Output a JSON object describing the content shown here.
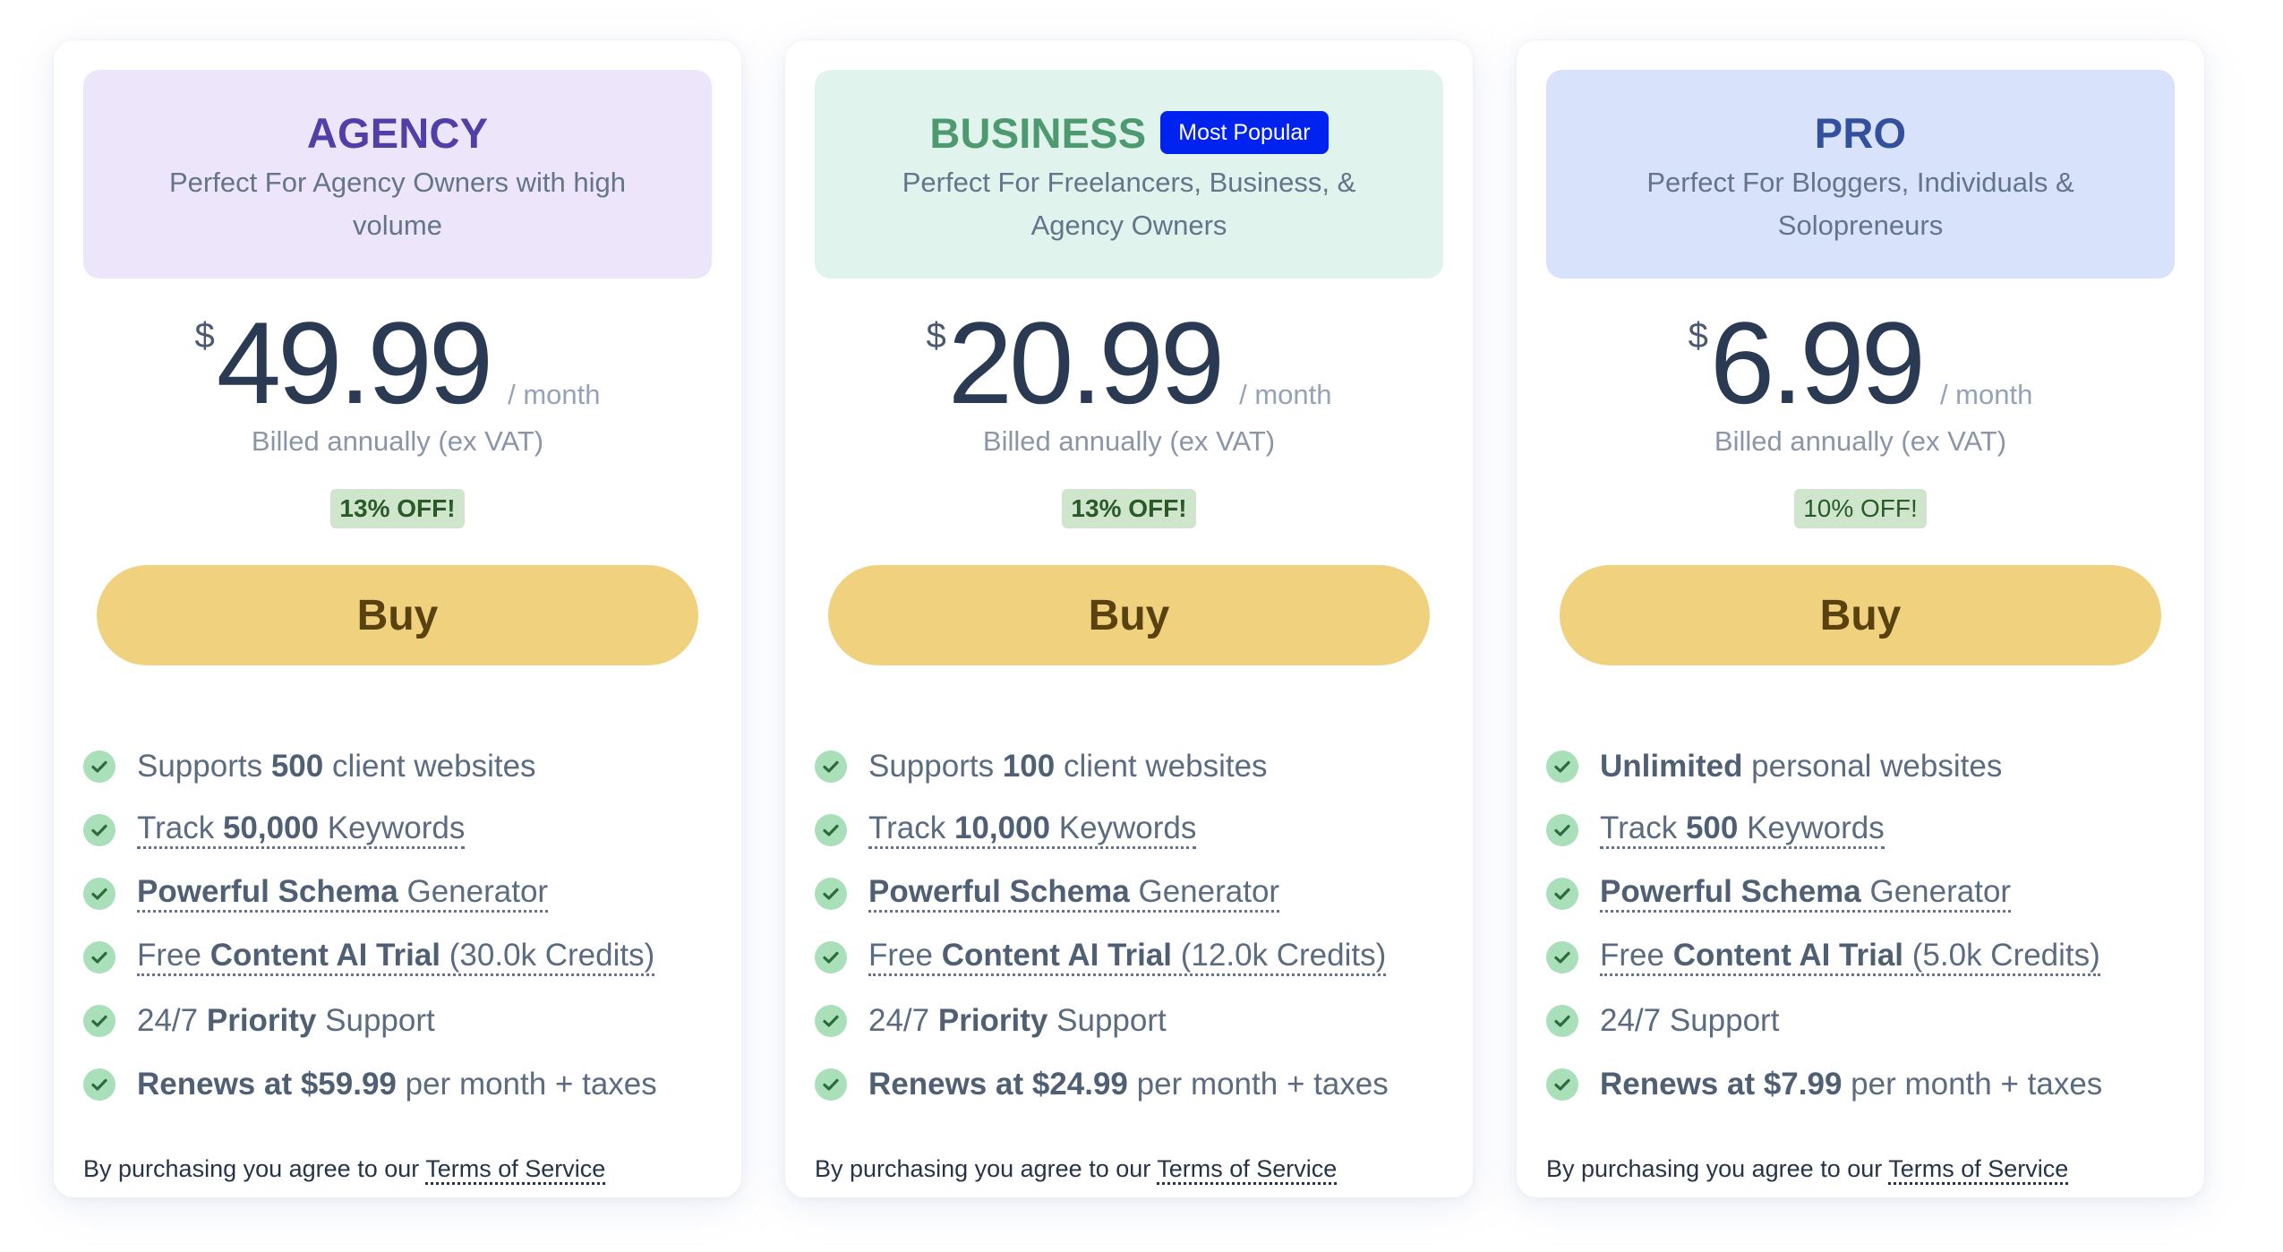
{
  "plans": [
    {
      "name": "AGENCY",
      "name_color": "#4f3fa6",
      "header_bg": "#ede6fb",
      "badge": null,
      "description": "Perfect For Agency Owners with high volume",
      "currency": "$",
      "price": "49.99",
      "period": "/ month",
      "billing_note": "Billed annually (ex VAT)",
      "discount": "13% OFF!",
      "buy_label": "Buy",
      "features": [
        {
          "parts": [
            {
              "t": "Supports ",
              "b": false
            },
            {
              "t": "500",
              "b": true
            },
            {
              "t": " client websites",
              "b": false
            }
          ],
          "dotted": false
        },
        {
          "parts": [
            {
              "t": "Track ",
              "b": false
            },
            {
              "t": "50,000",
              "b": true
            },
            {
              "t": " Keywords",
              "b": false
            }
          ],
          "dotted": true
        },
        {
          "parts": [
            {
              "t": "Powerful Schema",
              "b": true
            },
            {
              "t": " Generator",
              "b": false
            }
          ],
          "dotted": true
        },
        {
          "parts": [
            {
              "t": "Free ",
              "b": false
            },
            {
              "t": "Content AI Trial",
              "b": true
            },
            {
              "t": " (30.0k Credits)",
              "b": false
            }
          ],
          "dotted": true
        },
        {
          "parts": [
            {
              "t": "24/7 ",
              "b": false
            },
            {
              "t": "Priority",
              "b": true
            },
            {
              "t": " Support",
              "b": false
            }
          ],
          "dotted": false
        },
        {
          "parts": [
            {
              "t": "Renews at $59.99",
              "b": true
            },
            {
              "t": " per month + taxes",
              "b": false
            }
          ],
          "dotted": false
        }
      ],
      "terms_prefix": "By purchasing you agree to our ",
      "terms_link": "Terms of Service"
    },
    {
      "name": "BUSINESS",
      "name_color": "#4e9a70",
      "header_bg": "#e0f3ec",
      "badge": "Most Popular",
      "description": "Perfect For Freelancers, Business, & Agency Owners",
      "currency": "$",
      "price": "20.99",
      "period": "/ month",
      "billing_note": "Billed annually (ex VAT)",
      "discount": "13% OFF!",
      "buy_label": "Buy",
      "features": [
        {
          "parts": [
            {
              "t": "Supports ",
              "b": false
            },
            {
              "t": "100",
              "b": true
            },
            {
              "t": " client websites",
              "b": false
            }
          ],
          "dotted": false
        },
        {
          "parts": [
            {
              "t": "Track ",
              "b": false
            },
            {
              "t": "10,000",
              "b": true
            },
            {
              "t": " Keywords",
              "b": false
            }
          ],
          "dotted": true
        },
        {
          "parts": [
            {
              "t": "Powerful Schema",
              "b": true
            },
            {
              "t": " Generator",
              "b": false
            }
          ],
          "dotted": true
        },
        {
          "parts": [
            {
              "t": "Free ",
              "b": false
            },
            {
              "t": "Content AI Trial",
              "b": true
            },
            {
              "t": " (12.0k Credits)",
              "b": false
            }
          ],
          "dotted": true
        },
        {
          "parts": [
            {
              "t": "24/7 ",
              "b": false
            },
            {
              "t": "Priority",
              "b": true
            },
            {
              "t": " Support",
              "b": false
            }
          ],
          "dotted": false
        },
        {
          "parts": [
            {
              "t": "Renews at $24.99",
              "b": true
            },
            {
              "t": " per month + taxes",
              "b": false
            }
          ],
          "dotted": false
        }
      ],
      "terms_prefix": "By purchasing you agree to our ",
      "terms_link": "Terms of Service"
    },
    {
      "name": "PRO",
      "name_color": "#33509c",
      "header_bg": "#d8e2fb",
      "badge": null,
      "description": "Perfect For Bloggers, Individuals & Solopreneurs",
      "currency": "$",
      "price": "6.99",
      "period": "/ month",
      "billing_note": "Billed annually (ex VAT)",
      "discount": "10% OFF!",
      "buy_label": "Buy",
      "features": [
        {
          "parts": [
            {
              "t": "Unlimited",
              "b": true
            },
            {
              "t": " personal websites",
              "b": false
            }
          ],
          "dotted": false
        },
        {
          "parts": [
            {
              "t": "Track ",
              "b": false
            },
            {
              "t": "500",
              "b": true
            },
            {
              "t": " Keywords",
              "b": false
            }
          ],
          "dotted": true
        },
        {
          "parts": [
            {
              "t": "Powerful Schema",
              "b": true
            },
            {
              "t": " Generator",
              "b": false
            }
          ],
          "dotted": true
        },
        {
          "parts": [
            {
              "t": "Free ",
              "b": false
            },
            {
              "t": "Content AI Trial",
              "b": true
            },
            {
              "t": " (5.0k Credits)",
              "b": false
            }
          ],
          "dotted": true
        },
        {
          "parts": [
            {
              "t": "24/7 Support",
              "b": false
            }
          ],
          "dotted": false
        },
        {
          "parts": [
            {
              "t": "Renews at $7.99",
              "b": true
            },
            {
              "t": " per month + taxes",
              "b": false
            }
          ],
          "dotted": false
        }
      ],
      "terms_prefix": "By purchasing you agree to our ",
      "terms_link": "Terms of Service"
    }
  ],
  "icons": {
    "feature_check": "check-circle-icon"
  },
  "colors": {
    "buy_button_bg": "#f0d17e",
    "buy_button_text": "#5a4210",
    "discount_bg": "#cfe6cd",
    "discount_text": "#2a5a2a",
    "popular_badge_bg": "#0022ee",
    "check_bg": "#a9dfb9",
    "check_mark": "#2d6a3c"
  }
}
